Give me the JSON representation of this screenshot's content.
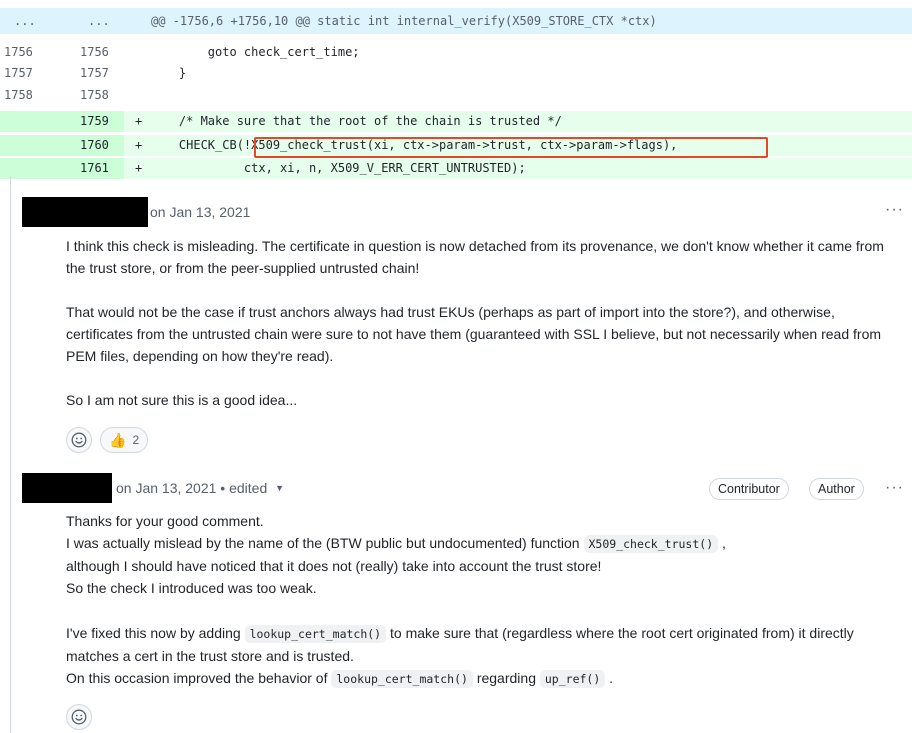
{
  "diff": {
    "hunk_left": "...",
    "hunk_right": "...",
    "hunk_header": "@@ -1756,6 +1756,10 @@ static int internal_verify(X509_STORE_CTX *ctx)",
    "lines": [
      {
        "old": "1756",
        "new": "1756",
        "sign": "",
        "code": "        goto check_cert_time;"
      },
      {
        "old": "1757",
        "new": "1757",
        "sign": "",
        "code": "    }"
      },
      {
        "old": "1758",
        "new": "1758",
        "sign": "",
        "code": ""
      },
      {
        "old": "",
        "new": "1759",
        "sign": "+",
        "code": "    /* Make sure that the root of the chain is trusted */"
      },
      {
        "old": "",
        "new": "1760",
        "sign": "+",
        "code": "    CHECK_CB(!X509_check_trust(xi, ctx->param->trust, ctx->param->flags),"
      },
      {
        "old": "",
        "new": "1761",
        "sign": "+",
        "code": "             ctx, xi, n, X509_V_ERR_CERT_UNTRUSTED);"
      }
    ]
  },
  "comment1": {
    "date": "on Jan 13, 2021",
    "more": "···",
    "p1": "I think this check is misleading. The certificate in question is now detached from its provenance, we don't know whether it came from the trust store, or from the peer-supplied untrusted chain!",
    "p2": "That would not be the case if trust anchors always had trust EKUs (perhaps as part of import into the store?), and otherwise, certificates from the untrusted chain were sure to not have them (guaranteed with SSL I believe, but not necessarily when read from PEM files, depending on how they're read).",
    "p3": "So I am not sure this is a good idea...",
    "thumbs_count": "2"
  },
  "comment2": {
    "date": "on Jan 13, 2021 • edited",
    "badge_contributor": "Contributor",
    "badge_author": "Author",
    "more": "···",
    "l1": "Thanks for your good comment.",
    "l2a": "I was actually mislead by the name of the (BTW public but undocumented) function ",
    "l2code": "X509_check_trust()",
    "l2b": " ,",
    "l3": "although I should have noticed that it does not (really) take into account the trust store!",
    "l4": "So the check I introduced was too weak.",
    "p2a": "I've fixed this now by adding ",
    "p2code": "lookup_cert_match()",
    "p2b": " to make sure that (regardless where the root cert originated from) it directly matches a cert in the trust store and is trusted.",
    "p3a": "On this occasion improved the behavior of ",
    "p3code1": "lookup_cert_match()",
    "p3b": " regarding ",
    "p3code2": "up_ref()",
    "p3c": " ."
  },
  "colors": {
    "hunk_bg": "#ddf4ff",
    "add_bg": "#e6ffec",
    "add_num_bg": "#ccffd8",
    "highlight_border": "#e4472b"
  }
}
